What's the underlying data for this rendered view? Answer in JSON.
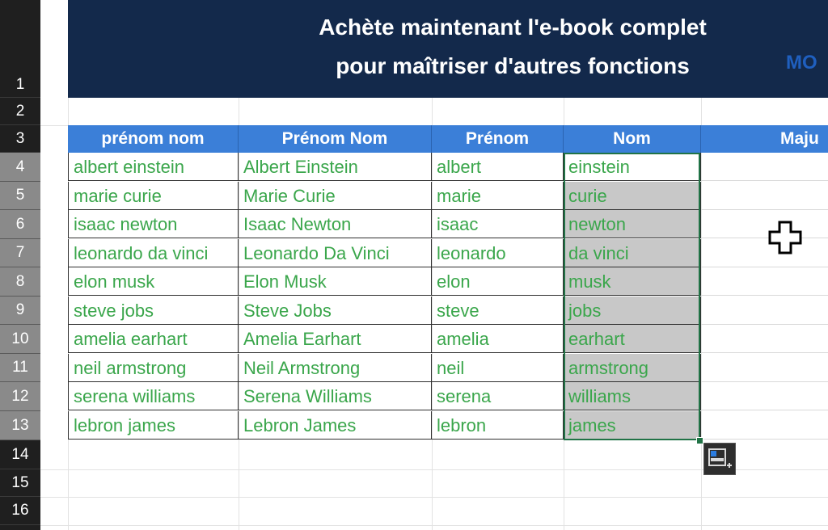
{
  "banner": {
    "line1": "Achète maintenant l'e-book complet",
    "line2": "pour maîtriser d'autres fonctions",
    "cut_text": "MO"
  },
  "row_numbers": [
    "1",
    "2",
    "3",
    "4",
    "5",
    "6",
    "7",
    "8",
    "9",
    "10",
    "11",
    "12",
    "13",
    "14",
    "15",
    "16"
  ],
  "table": {
    "headers": [
      "prénom nom",
      "Prénom Nom",
      "Prénom",
      "Nom",
      "Maju"
    ],
    "rows": [
      [
        "albert einstein",
        "Albert Einstein",
        "albert",
        "einstein"
      ],
      [
        "marie curie",
        "Marie Curie",
        "marie",
        "curie"
      ],
      [
        "isaac newton",
        "Isaac Newton",
        "isaac",
        "newton"
      ],
      [
        "leonardo da vinci",
        "Leonardo Da Vinci",
        "leonardo",
        "da vinci"
      ],
      [
        "elon musk",
        "Elon Musk",
        "elon",
        "musk"
      ],
      [
        "steve jobs",
        "Steve Jobs",
        "steve",
        "jobs"
      ],
      [
        "amelia earhart",
        "Amelia Earhart",
        "amelia",
        "earhart"
      ],
      [
        "neil armstrong",
        "Neil Armstrong",
        "neil",
        "armstrong"
      ],
      [
        "serena williams",
        "Serena Williams",
        "serena",
        "williams"
      ],
      [
        "lebron james",
        "Lebron James",
        "lebron",
        "james"
      ]
    ]
  },
  "icons": {
    "quick_analysis": "quick-analysis-icon",
    "cursor": "cell-select-cursor-icon"
  },
  "colors": {
    "banner": "#13294b",
    "header": "#3b7fd8",
    "text_green": "#3aa64b",
    "selection": "#217346"
  }
}
